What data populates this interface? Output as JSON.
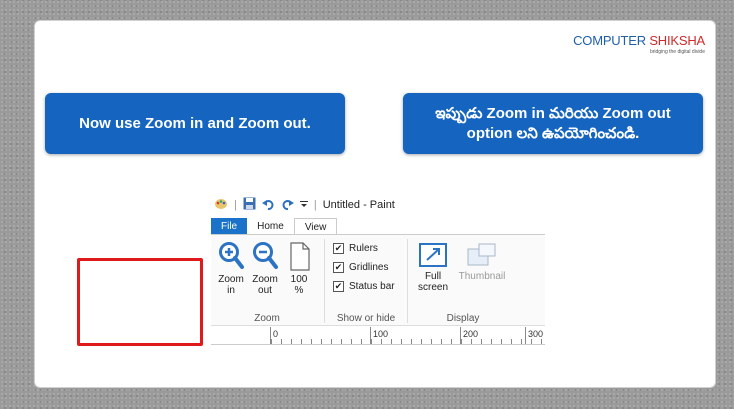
{
  "logo": {
    "brand_a": "COMPUTER",
    "brand_b": "SHIKSHA",
    "tagline": "bridging the digital divide"
  },
  "callouts": {
    "english": "Now use Zoom in and Zoom out.",
    "telugu_line1": "ఇప్పుడు Zoom in మరియు Zoom out",
    "telugu_line2": "option లని ఉపయోగించండి."
  },
  "paint": {
    "window_title": "Untitled - Paint",
    "tabs": [
      "File",
      "Home",
      "View"
    ],
    "zoom_group": {
      "label": "Zoom",
      "zoom_in": {
        "line1": "Zoom",
        "line2": "in"
      },
      "zoom_out": {
        "line1": "Zoom",
        "line2": "out"
      },
      "actual": {
        "line1": "100",
        "line2": "%"
      }
    },
    "show_hide_group": {
      "label": "Show or hide",
      "items": [
        {
          "label": "Rulers",
          "checked": true
        },
        {
          "label": "Gridlines",
          "checked": true
        },
        {
          "label": "Status bar",
          "checked": true
        }
      ]
    },
    "display_group": {
      "label": "Display",
      "full_screen": {
        "line1": "Full",
        "line2": "screen"
      },
      "thumbnail": "Thumbnail"
    },
    "ruler": [
      "0",
      "100",
      "200",
      "300"
    ]
  },
  "colors": {
    "callout_bg": "#1565c0",
    "file_tab": "#1a73c8",
    "highlight": "#e01a1a"
  }
}
